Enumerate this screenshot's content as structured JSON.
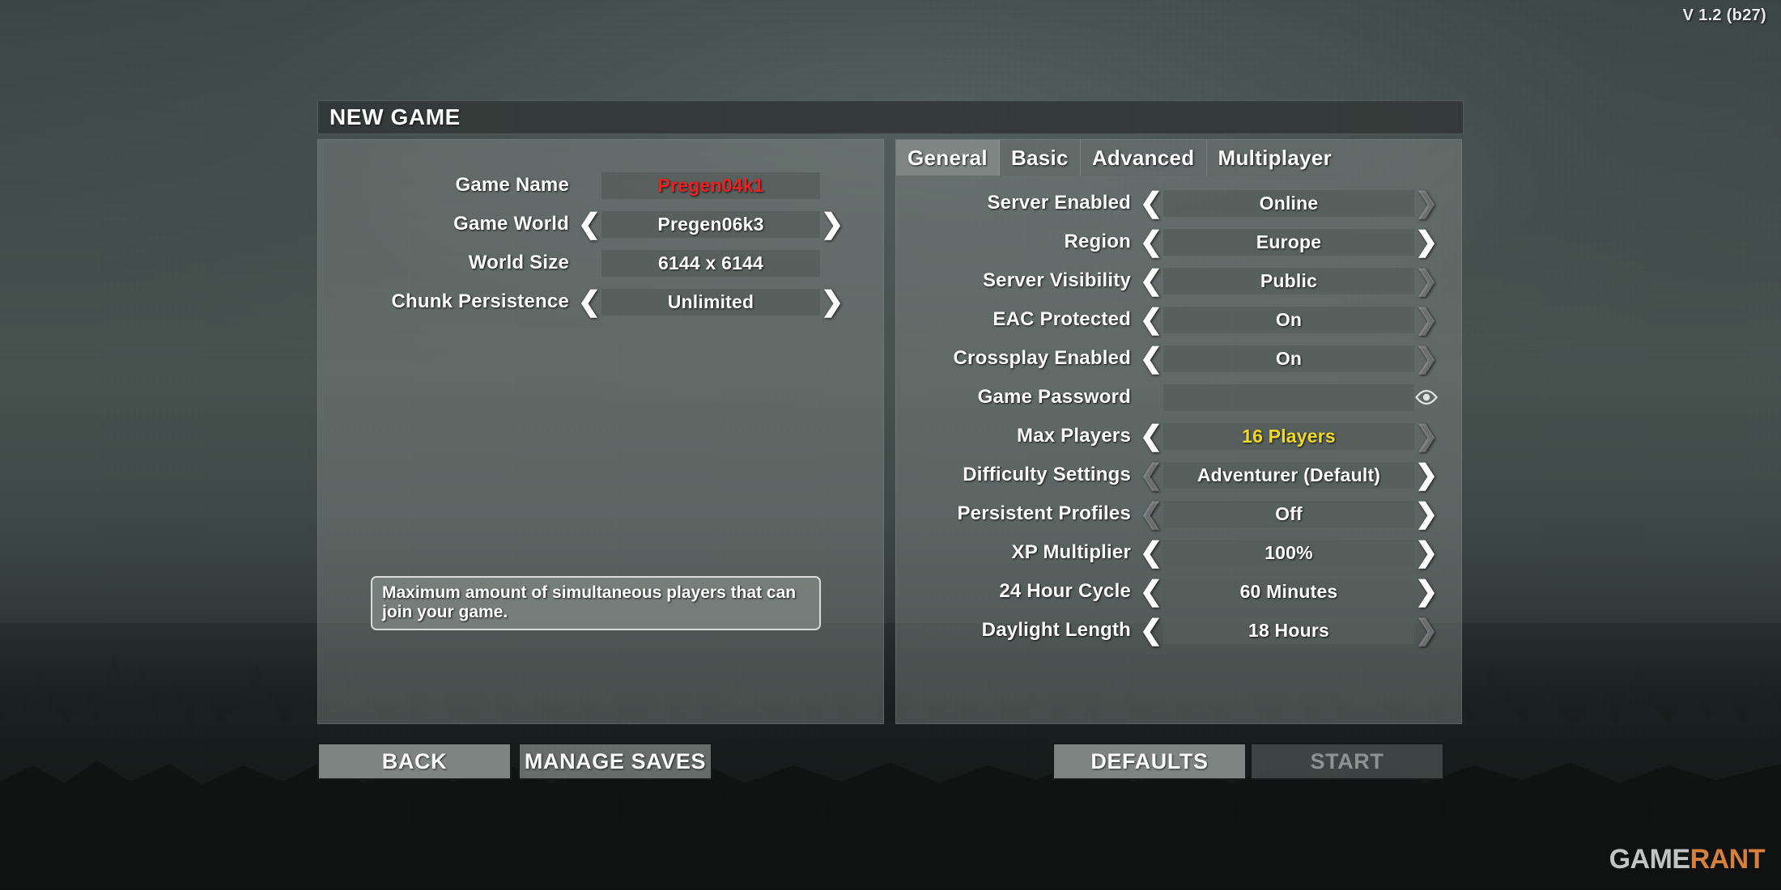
{
  "version_label": "V 1.2 (b27)",
  "watermark": {
    "part_a": "GAME",
    "part_b": "RANT"
  },
  "dialog": {
    "title": "NEW GAME"
  },
  "colors": {
    "accent_red": "#ef1f1f",
    "accent_yellow": "#f2dc28",
    "panel": "#808884",
    "field": "#555c5a",
    "watermark_orange": "#d9813c"
  },
  "left_panel": {
    "rows": [
      {
        "label": "Game Name",
        "value": "Pregen04k1",
        "left_arrow": "none",
        "right_arrow": "none",
        "value_style": "accent-red",
        "icon": "none"
      },
      {
        "label": "Game World",
        "value": "Pregen06k3",
        "left_arrow": "bright",
        "right_arrow": "bright",
        "value_style": "normal",
        "icon": "none"
      },
      {
        "label": "World Size",
        "value": "6144 x 6144",
        "left_arrow": "none",
        "right_arrow": "none",
        "value_style": "normal",
        "icon": "none"
      },
      {
        "label": "Chunk Persistence",
        "value": "Unlimited",
        "left_arrow": "bright",
        "right_arrow": "bright",
        "value_style": "normal",
        "icon": "none"
      }
    ]
  },
  "right_panel": {
    "tabs": [
      {
        "label": "General",
        "active": true
      },
      {
        "label": "Basic",
        "active": false
      },
      {
        "label": "Advanced",
        "active": false
      },
      {
        "label": "Multiplayer",
        "active": false
      }
    ],
    "rows": [
      {
        "label": "Server Enabled",
        "value": "Online",
        "left_arrow": "bright",
        "right_arrow": "dim",
        "value_style": "normal",
        "icon": "none"
      },
      {
        "label": "Region",
        "value": "Europe",
        "left_arrow": "bright",
        "right_arrow": "bright",
        "value_style": "normal",
        "icon": "none"
      },
      {
        "label": "Server Visibility",
        "value": "Public",
        "left_arrow": "bright",
        "right_arrow": "dim",
        "value_style": "normal",
        "icon": "none"
      },
      {
        "label": "EAC Protected",
        "value": "On",
        "left_arrow": "bright",
        "right_arrow": "dim",
        "value_style": "normal",
        "icon": "none"
      },
      {
        "label": "Crossplay Enabled",
        "value": "On",
        "left_arrow": "bright",
        "right_arrow": "dim",
        "value_style": "normal",
        "icon": "none"
      },
      {
        "label": "Game Password",
        "value": "",
        "left_arrow": "none",
        "right_arrow": "none",
        "value_style": "blank",
        "icon": "eye-icon"
      },
      {
        "label": "Max Players",
        "value": "16 Players",
        "left_arrow": "bright",
        "right_arrow": "dim",
        "value_style": "accent-yellow",
        "icon": "none"
      },
      {
        "label": "Difficulty Settings",
        "value": "Adventurer (Default)",
        "left_arrow": "dim",
        "right_arrow": "bright",
        "value_style": "normal",
        "icon": "none"
      },
      {
        "label": "Persistent Profiles",
        "value": "Off",
        "left_arrow": "dim",
        "right_arrow": "bright",
        "value_style": "normal",
        "icon": "none"
      },
      {
        "label": "XP Multiplier",
        "value": "100%",
        "left_arrow": "bright",
        "right_arrow": "bright",
        "value_style": "normal",
        "icon": "none"
      },
      {
        "label": "24 Hour Cycle",
        "value": "60 Minutes",
        "left_arrow": "bright",
        "right_arrow": "bright",
        "value_style": "normal",
        "icon": "none"
      },
      {
        "label": "Daylight Length",
        "value": "18 Hours",
        "left_arrow": "bright",
        "right_arrow": "dim",
        "value_style": "normal",
        "icon": "none"
      }
    ]
  },
  "tooltip": {
    "text": "Maximum amount of simultaneous players that can join your game."
  },
  "footer": {
    "back": "BACK",
    "manage_saves": "MANAGE SAVES",
    "defaults": "DEFAULTS",
    "start": "START"
  },
  "icons": {
    "left_arrow": "chevron-left-icon",
    "right_arrow": "chevron-right-icon",
    "password_reveal": "eye-icon"
  }
}
